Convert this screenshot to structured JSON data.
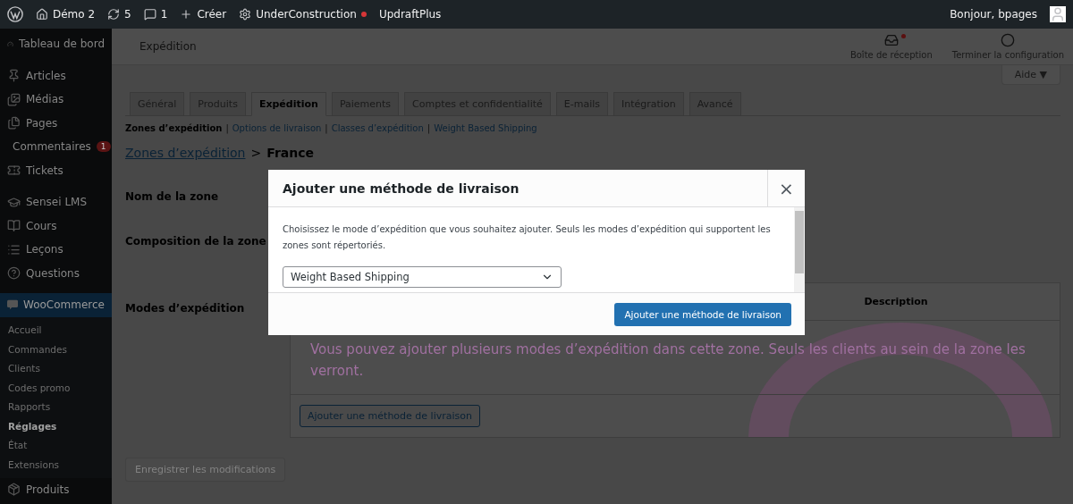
{
  "admin_bar": {
    "items": [
      {
        "kind": "logo"
      },
      {
        "kind": "home",
        "label": "Démo 2"
      },
      {
        "kind": "updates",
        "label": "5"
      },
      {
        "kind": "comments",
        "label": "1"
      },
      {
        "kind": "new",
        "label": "Créer"
      },
      {
        "kind": "plugin",
        "label": "UnderConstruction",
        "alert": true
      },
      {
        "kind": "text",
        "label": "UpdraftPlus"
      }
    ],
    "greeting": "Bonjour, bpages"
  },
  "sidebar": {
    "items": [
      {
        "kind": "dashboard",
        "label": "Tableau de bord",
        "selected": false
      },
      {
        "kind": "sep"
      },
      {
        "kind": "pin",
        "label": "Articles",
        "selected": false
      },
      {
        "kind": "media",
        "label": "Médias",
        "selected": false
      },
      {
        "kind": "pages",
        "label": "Pages",
        "selected": false
      },
      {
        "kind": "comments",
        "label": "Commentaires",
        "badge": "1",
        "selected": false
      },
      {
        "kind": "tickets",
        "label": "Tickets",
        "selected": false
      },
      {
        "kind": "sep"
      },
      {
        "kind": "cap",
        "label": "Sensei LMS",
        "selected": false
      },
      {
        "kind": "book",
        "label": "Cours",
        "selected": false
      },
      {
        "kind": "list",
        "label": "Leçons",
        "selected": false
      },
      {
        "kind": "help",
        "label": "Questions",
        "selected": false
      },
      {
        "kind": "sep"
      },
      {
        "kind": "woo",
        "label": "WooCommerce",
        "selected": true,
        "children": [
          {
            "label": "Accueil",
            "selected": false
          },
          {
            "label": "Commandes",
            "selected": false
          },
          {
            "label": "Clients",
            "selected": false
          },
          {
            "label": "Codes promo",
            "selected": false
          },
          {
            "label": "Rapports",
            "selected": false
          },
          {
            "label": "Réglages",
            "selected": true
          },
          {
            "label": "État",
            "selected": false
          },
          {
            "label": "Extensions",
            "selected": false
          }
        ]
      },
      {
        "kind": "box",
        "label": "Produits",
        "selected": false
      }
    ]
  },
  "header": {
    "title": "Expédition",
    "actions": [
      {
        "kind": "inbox",
        "label": "Boîte de réception",
        "alert": true
      },
      {
        "kind": "circle",
        "label": "Terminer la configuration",
        "alert": false
      }
    ]
  },
  "help_button": "Aide ▼",
  "tabs": [
    {
      "label": "Général",
      "selected": false
    },
    {
      "label": "Produits",
      "selected": false
    },
    {
      "label": "Expédition",
      "selected": true
    },
    {
      "label": "Paiements",
      "selected": false
    },
    {
      "label": "Comptes et confidentialité",
      "selected": false
    },
    {
      "label": "E-mails",
      "selected": false
    },
    {
      "label": "Intégration",
      "selected": false
    },
    {
      "label": "Avancé",
      "selected": false
    }
  ],
  "subnav": [
    {
      "label": "Zones d’expédition",
      "selected": true
    },
    {
      "divider": "|",
      "label": "Options de livraison",
      "selected": false
    },
    {
      "divider": "|",
      "label": "Classes d’expédition",
      "selected": false
    },
    {
      "divider": "|",
      "label": "Weight Based Shipping",
      "selected": false
    }
  ],
  "breadcrumb": {
    "link": "Zones d’expédition",
    "separator": ">",
    "current": "France"
  },
  "form": {
    "rows": [
      "Nom de la zone",
      "Composition de la zone",
      "Modes d’expédition"
    ]
  },
  "methods_table": {
    "columns": [
      "Description"
    ],
    "empty_message": "Vous pouvez ajouter plusieurs modes d’expédition dans cette zone. Seuls les clients au sein de la zone les verront.",
    "add_button": "Ajouter une méthode de livraison"
  },
  "save_button": {
    "label": "Enregistrer les modifications",
    "disabled": true
  },
  "modal": {
    "title": "Ajouter une méthode de livraison",
    "close": "×",
    "description": "Choisissez le mode d’expédition que vous souhaitez ajouter. Seuls les modes d’expédition qui supportent les zones sont répertoriés.",
    "select_value": "Weight Based Shipping",
    "submit": "Ajouter une méthode de livraison"
  }
}
